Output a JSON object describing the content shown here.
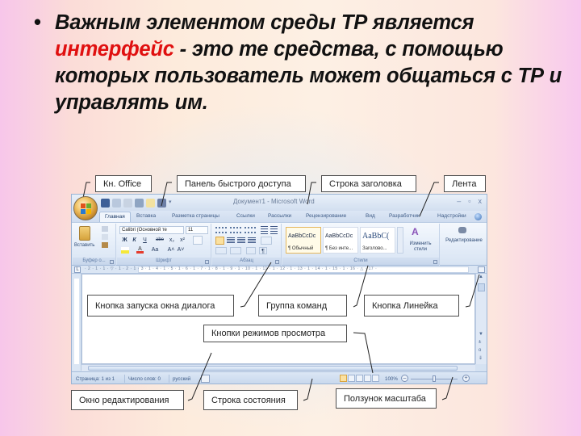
{
  "slide": {
    "bullet_symbol": "•",
    "text_part1": "Важным элементом среды ТР является ",
    "text_highlight": "интерфейс",
    "text_part2": " - это те средства, с помощью которых пользователь может общаться с ТР и управлять им.",
    "highlight_color": "#e01010"
  },
  "word_window": {
    "title": "Документ1 - Microsoft Word",
    "window_controls": [
      "–",
      "▫",
      "x"
    ],
    "quick_access_icons": [
      "save-icon",
      "undo-icon",
      "redo-icon",
      "print-preview-icon",
      "new-document-icon",
      "spelling-icon",
      "customize-dropdown-icon"
    ],
    "tabs": [
      "Главная",
      "Вставка",
      "Разметка страницы",
      "Ссылки",
      "Рассылки",
      "Рецензирование",
      "Вид",
      "Разработчик",
      "Надстройки"
    ],
    "ribbon": {
      "clipboard": {
        "label": "Буфер о...",
        "paste_label": "Вставить"
      },
      "font": {
        "label": "Шрифт",
        "font_name": "Calibri (Основной те",
        "font_size": "11",
        "buttons": [
          "Ж",
          "К",
          "Ч",
          "abe",
          "x₂",
          "x²",
          "Aa",
          "A˄",
          "A˅"
        ]
      },
      "paragraph": {
        "label": "Абзац",
        "pilcrow": "¶"
      },
      "styles": {
        "label": "Стили",
        "items": [
          {
            "sample": "AaBbCcDc",
            "name": "¶ Обычный"
          },
          {
            "sample": "AaBbCcDc",
            "name": "¶ Без инте..."
          },
          {
            "sample": "AaBbC(",
            "name": "Заголово..."
          }
        ],
        "change_styles_label": "Изменить стили"
      },
      "editing": {
        "label": "Редактирование"
      }
    },
    "ruler_ticks": "· 2 · 1 · 1 · ▽ · 1 · 2 · 1 · 3 · 1 · 4 · 1 · 5 · 1 · 6 · 1 · 7 · 1 · 8 · 1 · 9 · 1 · 10 · 1 · 11 · 1 · 12 · 1 · 13 · 1 · 14 · 1 · 15 · 1 · 16 · △ · 17 ·",
    "status_bar": {
      "page": "Страница: 1 из 1",
      "words": "Число слов: 0",
      "language": "русский",
      "zoom": "100%",
      "zoom_level_percent": 100
    }
  },
  "callouts": {
    "office_button": "Кн. Office",
    "quick_access": "Панель быстрого  доступа",
    "title_bar": "Строка заголовка",
    "ribbon": "Лента",
    "dialog_launcher": "Кнопка  запуска окна диалога",
    "command_group": "Группа команд",
    "ruler_button": "Кнопка  Линейка",
    "view_modes": "Кнопки режимов просмотра",
    "edit_window": "Окно редактирования",
    "status_bar": "Строка  состояния",
    "zoom_slider": "Ползунок масштаба"
  }
}
